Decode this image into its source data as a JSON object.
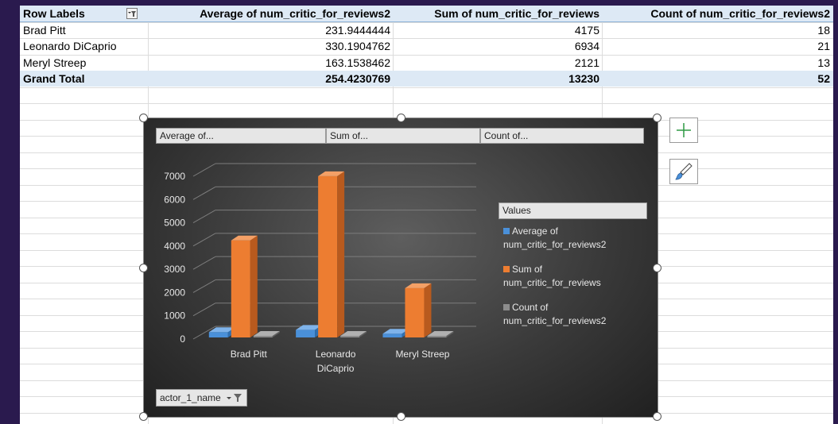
{
  "pivot": {
    "headers": {
      "row_labels": "Row Labels",
      "col1": "Average of num_critic_for_reviews2",
      "col2": "Sum of num_critic_for_reviews",
      "col3": "Count of num_critic_for_reviews2"
    },
    "rows": [
      {
        "label": "Brad Pitt",
        "avg": "231.9444444",
        "sum": "4175",
        "count": "18"
      },
      {
        "label": "Leonardo DiCaprio",
        "avg": "330.1904762",
        "sum": "6934",
        "count": "21"
      },
      {
        "label": "Meryl Streep",
        "avg": "163.1538462",
        "sum": "2121",
        "count": "13"
      }
    ],
    "total": {
      "label": "Grand Total",
      "avg": "254.4230769",
      "sum": "13230",
      "count": "52"
    }
  },
  "chart": {
    "field_buttons": [
      "Average of...",
      "Sum of...",
      "Count of..."
    ],
    "axis_field_button": "actor_1_name",
    "legend_title": "Values",
    "legend_entries": [
      {
        "line1": "Average of",
        "line2": "num_critic_for_reviews2",
        "color": "#4a90d9"
      },
      {
        "line1": "Sum of",
        "line2": "num_critic_for_reviews",
        "color": "#ed7d31"
      },
      {
        "line1": "Count of",
        "line2": "num_critic_for_reviews2",
        "color": "#8c8c8c"
      }
    ]
  },
  "chart_data": {
    "type": "bar",
    "categories": [
      [
        "Brad Pitt"
      ],
      [
        "Leonardo",
        "DiCaprio"
      ],
      [
        "Meryl Streep"
      ]
    ],
    "series": [
      {
        "name": "Average of num_critic_for_reviews2",
        "values": [
          231.9444444,
          330.1904762,
          163.1538462
        ],
        "color": "#4a90d9"
      },
      {
        "name": "Sum of num_critic_for_reviews",
        "values": [
          4175,
          6934,
          2121
        ],
        "color": "#ed7d31"
      },
      {
        "name": "Count of num_critic_for_reviews2",
        "values": [
          18,
          21,
          13
        ],
        "color": "#8c8c8c"
      }
    ],
    "y_ticks": [
      "0",
      "1000",
      "2000",
      "3000",
      "4000",
      "5000",
      "6000",
      "7000"
    ],
    "ylim": [
      0,
      7000
    ],
    "legend_position": "right",
    "grid": true
  }
}
